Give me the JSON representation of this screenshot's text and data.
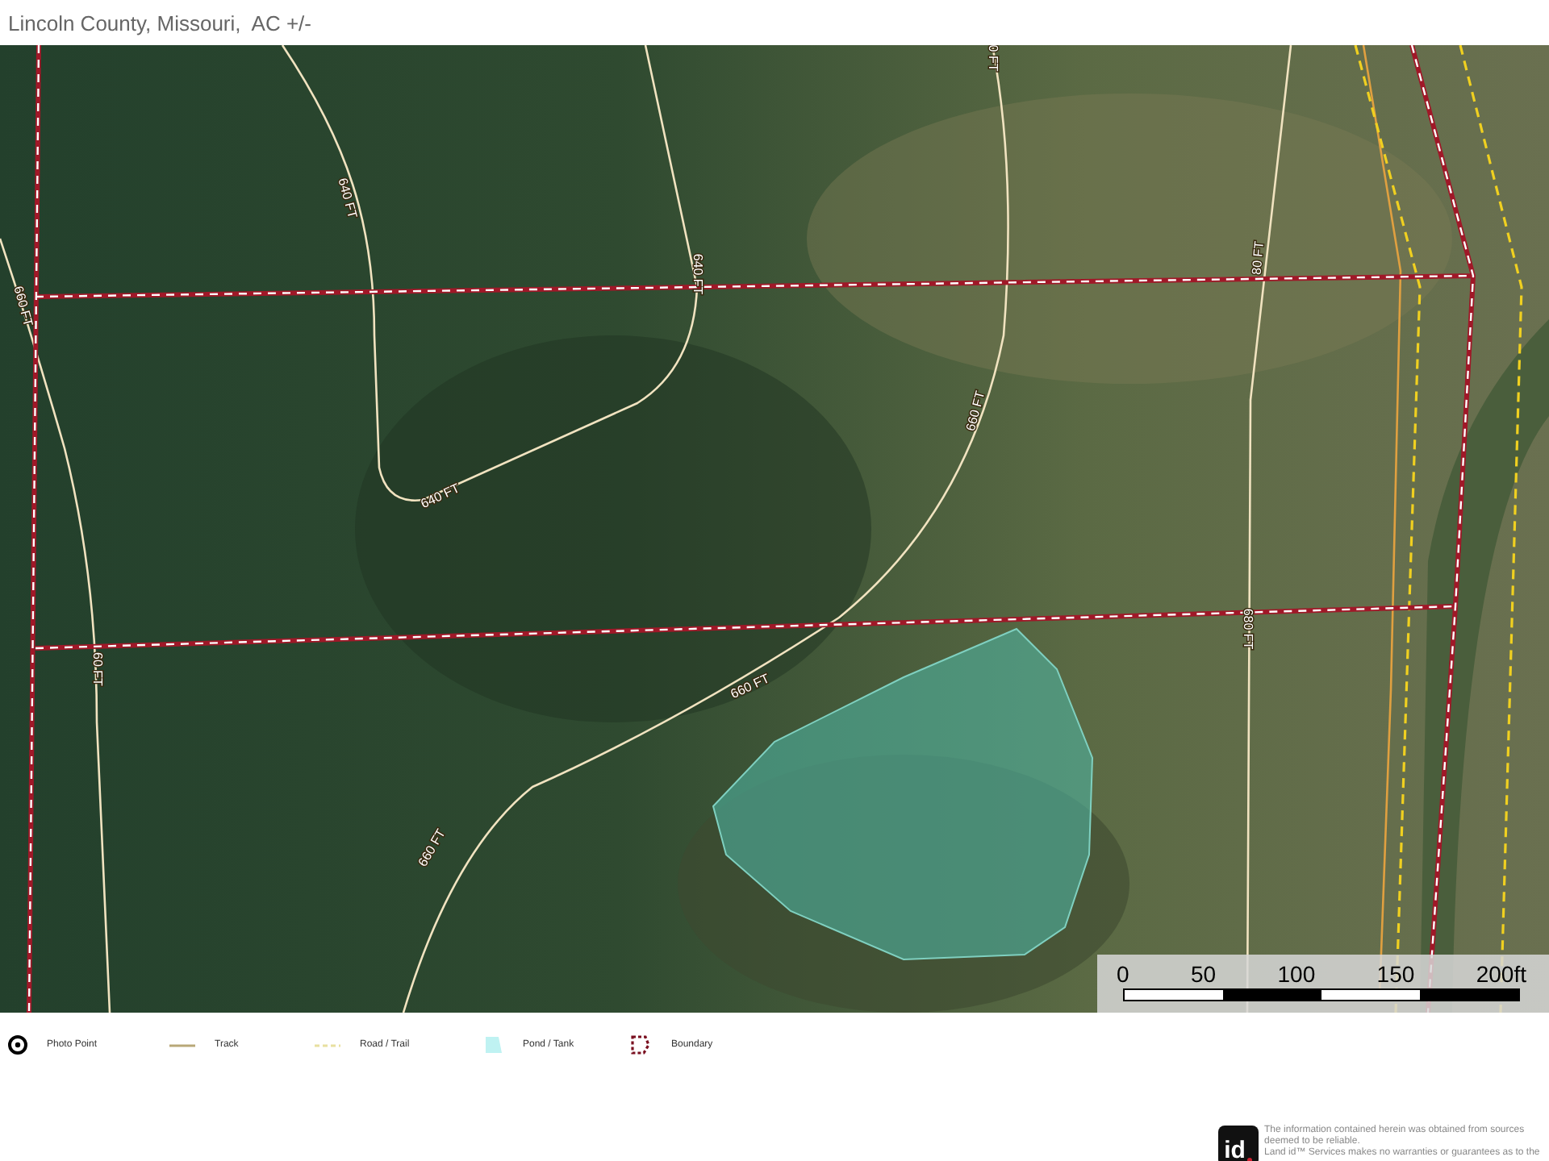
{
  "header": {
    "subtitle": "Lincoln County, Missouri,  AC +/-"
  },
  "map": {
    "contour_labels": [
      {
        "text": "640 FT"
      },
      {
        "text": "640 FT"
      },
      {
        "text": "640 FT"
      },
      {
        "text": "0 FT"
      },
      {
        "text": "660 FT"
      },
      {
        "text": "660 FT"
      },
      {
        "text": "660 FT"
      },
      {
        "text": "660 FT"
      },
      {
        "text": "60 FT"
      },
      {
        "text": "680 FT"
      },
      {
        "text": "80 FT"
      }
    ],
    "scale_bar": {
      "labels": [
        "0",
        "50",
        "100",
        "150",
        "200ft"
      ]
    }
  },
  "legend": [
    {
      "kind": "photo_point",
      "label": "Photo Point"
    },
    {
      "kind": "track",
      "label": "Track"
    },
    {
      "kind": "road",
      "label": "Road / Trail"
    },
    {
      "kind": "pond",
      "label": "Pond / Tank"
    },
    {
      "kind": "boundary",
      "label": "Boundary"
    }
  ],
  "footer": {
    "logo": "id",
    "disclaimer": [
      "The information contained herein was obtained from sources deemed to be reliable.",
      "Land id™ Services makes no warranties or guarantees as to the"
    ]
  }
}
